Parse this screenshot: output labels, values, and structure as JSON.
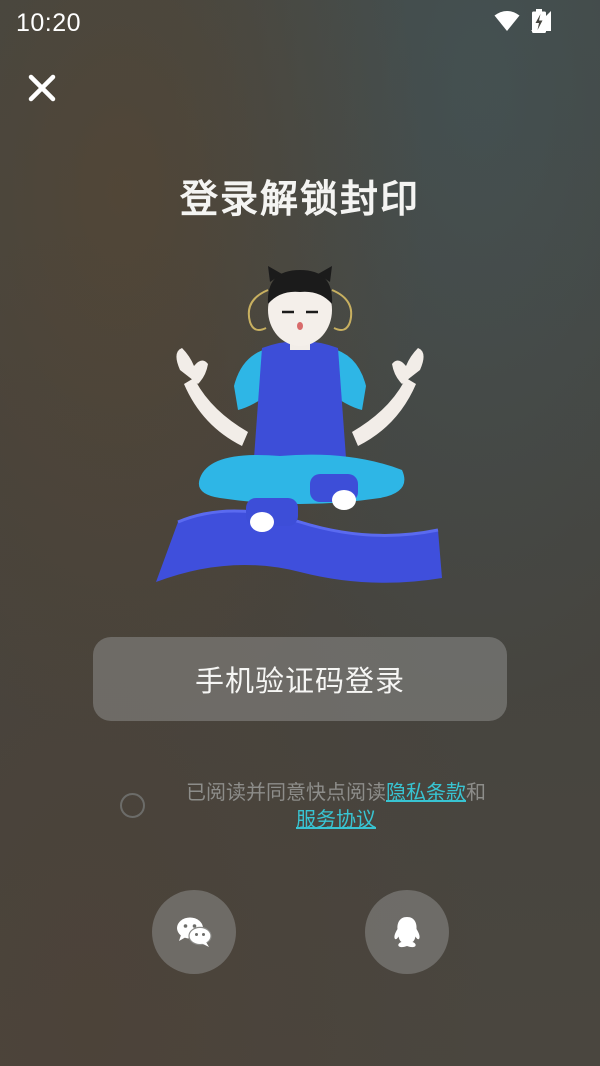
{
  "status_bar": {
    "time": "10:20",
    "icons": [
      "wifi-icon",
      "signal-icon",
      "battery-charging-icon"
    ]
  },
  "header": {
    "close_icon": "close-icon",
    "title": "登录解锁封印"
  },
  "illustration": {
    "name": "meditating-character-illustration"
  },
  "login": {
    "phone_button_label": "手机验证码登录"
  },
  "agreement": {
    "checked": false,
    "text_prefix": "已阅读并同意快点阅读",
    "privacy_link": "隐私条款",
    "conjunction": "和",
    "service_link": "服务协议"
  },
  "social_login": {
    "items": [
      {
        "icon": "wechat-icon"
      },
      {
        "icon": "qq-icon"
      }
    ]
  },
  "colors": {
    "link": "#38c4d2",
    "button_bg": "#8c8c8a",
    "background": "#45453f"
  }
}
